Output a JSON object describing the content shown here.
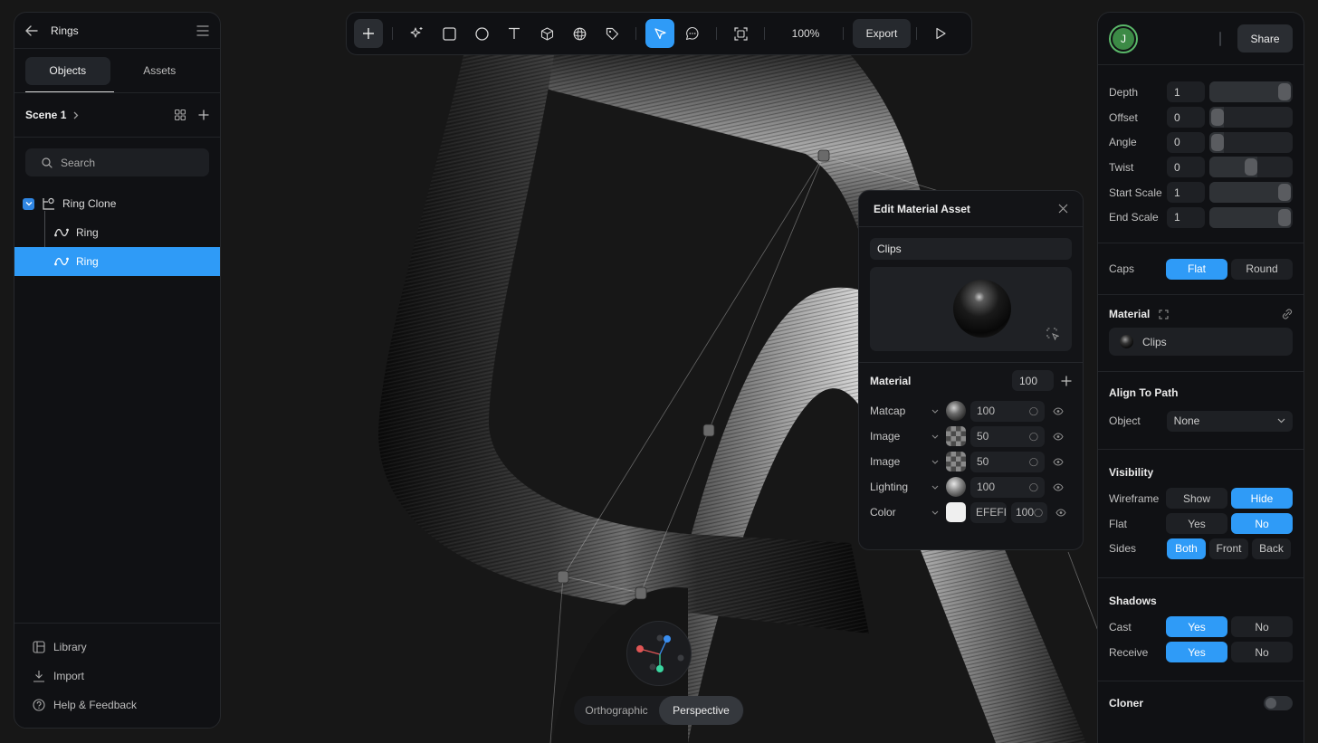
{
  "app": {
    "project_title": "Rings"
  },
  "left": {
    "tabs": [
      {
        "label": "Objects"
      },
      {
        "label": "Assets"
      }
    ],
    "scene_label": "Scene 1",
    "search_placeholder": "Search",
    "tree": [
      {
        "label": "Ring Clone",
        "checked": true
      },
      {
        "label": "Ring"
      },
      {
        "label": "Ring",
        "selected": true
      }
    ],
    "footer": [
      {
        "label": "Library",
        "icon": "library-icon"
      },
      {
        "label": "Import",
        "icon": "import-icon"
      },
      {
        "label": "Help & Feedback",
        "icon": "help-icon"
      }
    ]
  },
  "toolbar": {
    "zoom": "100%",
    "export_label": "Export",
    "tools": [
      "plus-icon",
      "sparkle-icon",
      "rectangle-icon",
      "ellipse-icon",
      "text-icon",
      "cube-icon",
      "sphere-icon",
      "tag-icon",
      "pointer-icon",
      "comment-icon",
      "frame-icon",
      "play-icon"
    ]
  },
  "right": {
    "avatar_initial": "J",
    "share_label": "Share",
    "props": [
      {
        "name": "Depth",
        "value": "1",
        "level": 1.0
      },
      {
        "name": "Offset",
        "value": "0",
        "level": 0.0
      },
      {
        "name": "Angle",
        "value": "0",
        "level": 0.0
      },
      {
        "name": "Twist",
        "value": "0",
        "level": 0.5
      },
      {
        "name": "Start Scale",
        "value": "1",
        "level": 1.0
      },
      {
        "name": "End Scale",
        "value": "1",
        "level": 1.0
      }
    ],
    "caps": {
      "label": "Caps",
      "options": [
        "Flat",
        "Round"
      ],
      "selected": "Flat"
    },
    "material": {
      "title": "Material",
      "value": "Clips"
    },
    "align": {
      "title": "Align To Path",
      "object_label": "Object",
      "object_value": "None"
    },
    "visibility": {
      "title": "Visibility",
      "rows": [
        {
          "label": "Wireframe",
          "options": [
            "Show",
            "Hide"
          ],
          "selected": "Hide"
        },
        {
          "label": "Flat",
          "options": [
            "Yes",
            "No"
          ],
          "selected": "No"
        },
        {
          "label": "Sides",
          "options": [
            "Both",
            "Front",
            "Back"
          ],
          "selected": "Both"
        }
      ]
    },
    "shadows": {
      "title": "Shadows",
      "rows": [
        {
          "label": "Cast",
          "options": [
            "Yes",
            "No"
          ],
          "selected": "Yes"
        },
        {
          "label": "Receive",
          "options": [
            "Yes",
            "No"
          ],
          "selected": "Yes"
        }
      ]
    },
    "cloner": {
      "title": "Cloner",
      "enabled": false
    }
  },
  "material_popup": {
    "title": "Edit Material Asset",
    "name": "Clips",
    "material_label": "Material",
    "material_value": "100",
    "layers": [
      {
        "name": "Matcap",
        "value": "100",
        "swatch": "matcap"
      },
      {
        "name": "Image",
        "value": "50",
        "swatch": "check"
      },
      {
        "name": "Image",
        "value": "50",
        "swatch": "check"
      },
      {
        "name": "Lighting",
        "value": "100",
        "swatch": "light"
      },
      {
        "name": "Color",
        "value": "EFEFI",
        "opacity": "100",
        "swatch": "white"
      }
    ]
  },
  "camera": {
    "options": [
      "Orthographic",
      "Perspective"
    ],
    "selected": "Perspective"
  },
  "colors": {
    "accent": "#2f9bf7",
    "panel": "#101114",
    "avatar": "#3c8a46"
  }
}
